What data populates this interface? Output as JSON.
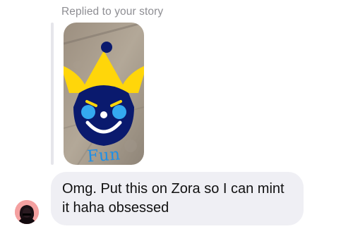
{
  "reply_context": {
    "label": "Replied to your story",
    "story_caption": "Fun"
  },
  "message": {
    "text": "Omg. Put this on Zora so I can mint it haha obsessed"
  },
  "avatar": {
    "icon": "profile-avatar-icon",
    "background_color": "#f4a0a0"
  },
  "colors": {
    "bubble": "#efeff4",
    "quote_bar": "#e6e6eb",
    "meta_text": "#8e8e93",
    "jester_hat": "#ffd60a",
    "jester_face": "#0a1a6e",
    "caption": "#1d8fe8"
  }
}
